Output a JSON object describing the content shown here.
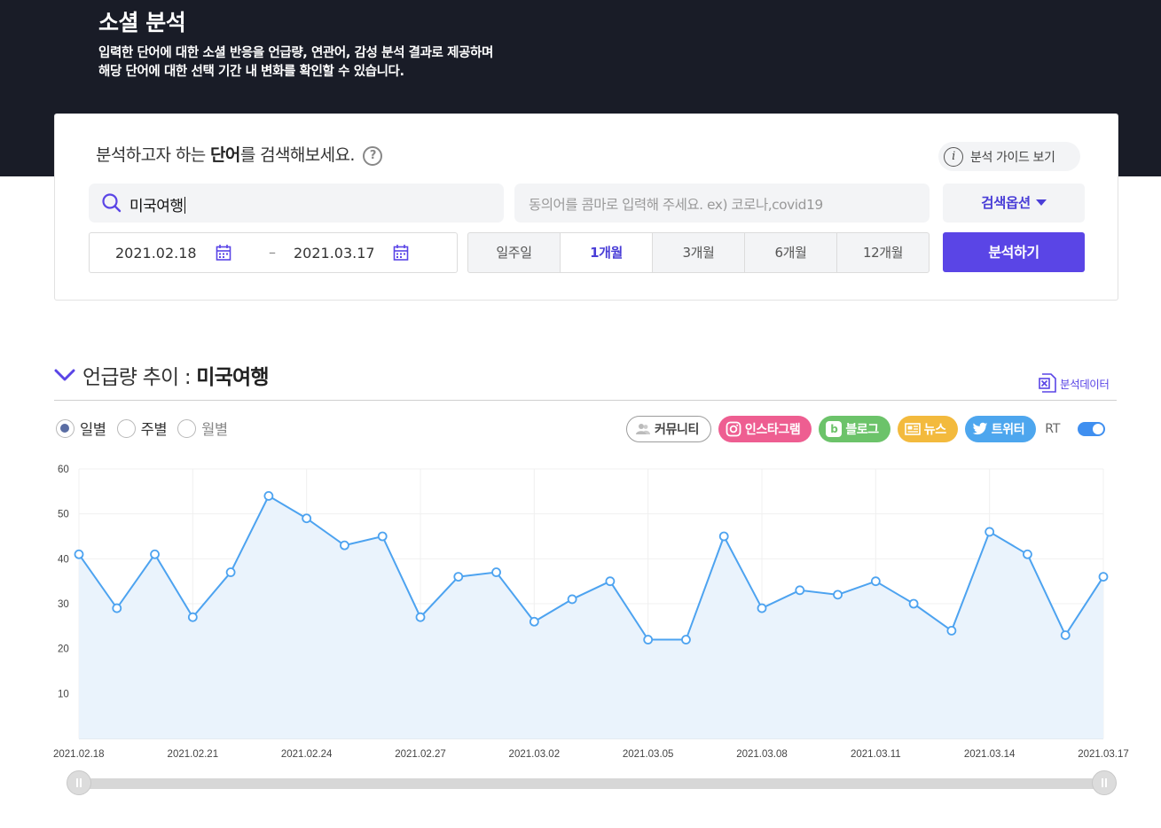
{
  "hero": {
    "title": "소셜 분석",
    "desc_line1": "입력한 단어에 대한 소셜 반응을 언급량, 연관어, 감성 분석 결과로 제공하며",
    "desc_line2": "해당 단어에 대한 선택 기간 내 변화를 확인할 수 있습니다."
  },
  "search": {
    "prompt_pre": "분석하고자 하는 ",
    "prompt_bold": "단어",
    "prompt_post": "를 검색해보세요.",
    "guide_label": "분석 가이드 보기",
    "keyword": "미국여행",
    "synonym_placeholder": "동의어를 콤마로 입력해 주세요. ex) 코로나,covid19",
    "options_label": "검색옵션",
    "start_date": "2021.02.18",
    "end_date": "2021.03.17",
    "date_separator": "–",
    "periods": [
      {
        "label": "일주일",
        "active": false
      },
      {
        "label": "1개월",
        "active": true
      },
      {
        "label": "3개월",
        "active": false
      },
      {
        "label": "6개월",
        "active": false
      },
      {
        "label": "12개월",
        "active": false
      }
    ],
    "analyze_label": "분석하기"
  },
  "trend": {
    "title_pre": "언급량 추이 : ",
    "title_keyword": "미국여행",
    "export_label": "분석데이터",
    "radios": [
      {
        "label": "일별",
        "selected": true
      },
      {
        "label": "주별",
        "selected": false
      },
      {
        "label": "월별",
        "selected": false
      }
    ],
    "channels": {
      "community": "커뮤니티",
      "instagram": "인스타그램",
      "blog": "블로그",
      "news": "뉴스",
      "twitter": "트위터",
      "rt": "RT"
    },
    "colors": {
      "accent": "#5a45e6",
      "line": "#4da3f0",
      "fill": "#eaf3fc"
    }
  },
  "chart_data": {
    "type": "area",
    "x": [
      "2021.02.18",
      "2021.02.19",
      "2021.02.20",
      "2021.02.21",
      "2021.02.22",
      "2021.02.23",
      "2021.02.24",
      "2021.02.25",
      "2021.02.26",
      "2021.02.27",
      "2021.02.28",
      "2021.03.01",
      "2021.03.02",
      "2021.03.03",
      "2021.03.04",
      "2021.03.05",
      "2021.03.06",
      "2021.03.07",
      "2021.03.08",
      "2021.03.09",
      "2021.03.10",
      "2021.03.11",
      "2021.03.12",
      "2021.03.13",
      "2021.03.14",
      "2021.03.15",
      "2021.03.16",
      "2021.03.17"
    ],
    "values": [
      41,
      29,
      41,
      27,
      37,
      54,
      49,
      43,
      45,
      27,
      36,
      37,
      26,
      31,
      35,
      22,
      22,
      45,
      29,
      33,
      32,
      35,
      30,
      24,
      46,
      41,
      23,
      36
    ],
    "x_tick_labels": [
      "2021.02.18",
      "2021.02.21",
      "2021.02.24",
      "2021.02.27",
      "2021.03.02",
      "2021.03.05",
      "2021.03.08",
      "2021.03.11",
      "2021.03.14",
      "2021.03.17"
    ],
    "y_ticks": [
      10,
      20,
      30,
      40,
      50,
      60
    ],
    "ylim": [
      0,
      60
    ],
    "grid": true
  }
}
